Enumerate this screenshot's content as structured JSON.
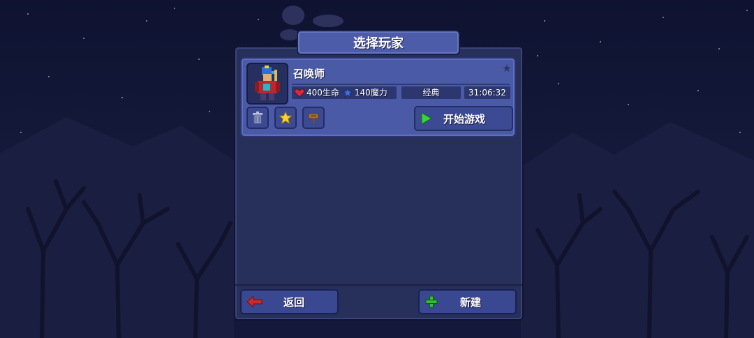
{
  "title": "选择玩家",
  "player": {
    "name": "召唤师",
    "health": "400生命",
    "mana": "140魔力",
    "difficulty": "经典",
    "playtime": "31:06:32"
  },
  "buttons": {
    "play": "开始游戏",
    "back": "返回",
    "new": "新建"
  },
  "icons": {
    "favorite": "star-icon",
    "delete": "trash-icon",
    "favorite_toggle": "gold-star-icon",
    "rename": "signpost-icon",
    "play": "play-triangle-icon",
    "back": "red-arrow-left-icon",
    "new": "green-plus-icon",
    "health": "heart-icon",
    "mana": "mana-star-icon"
  },
  "colors": {
    "panel": "#27305a",
    "card": "#4a5aa6",
    "button": "#3b4a92",
    "heart": "#e0283c",
    "mana": "#3f6fe0",
    "play": "#3ad13a",
    "back_arrow": "#d22828",
    "new_plus": "#30c030"
  }
}
